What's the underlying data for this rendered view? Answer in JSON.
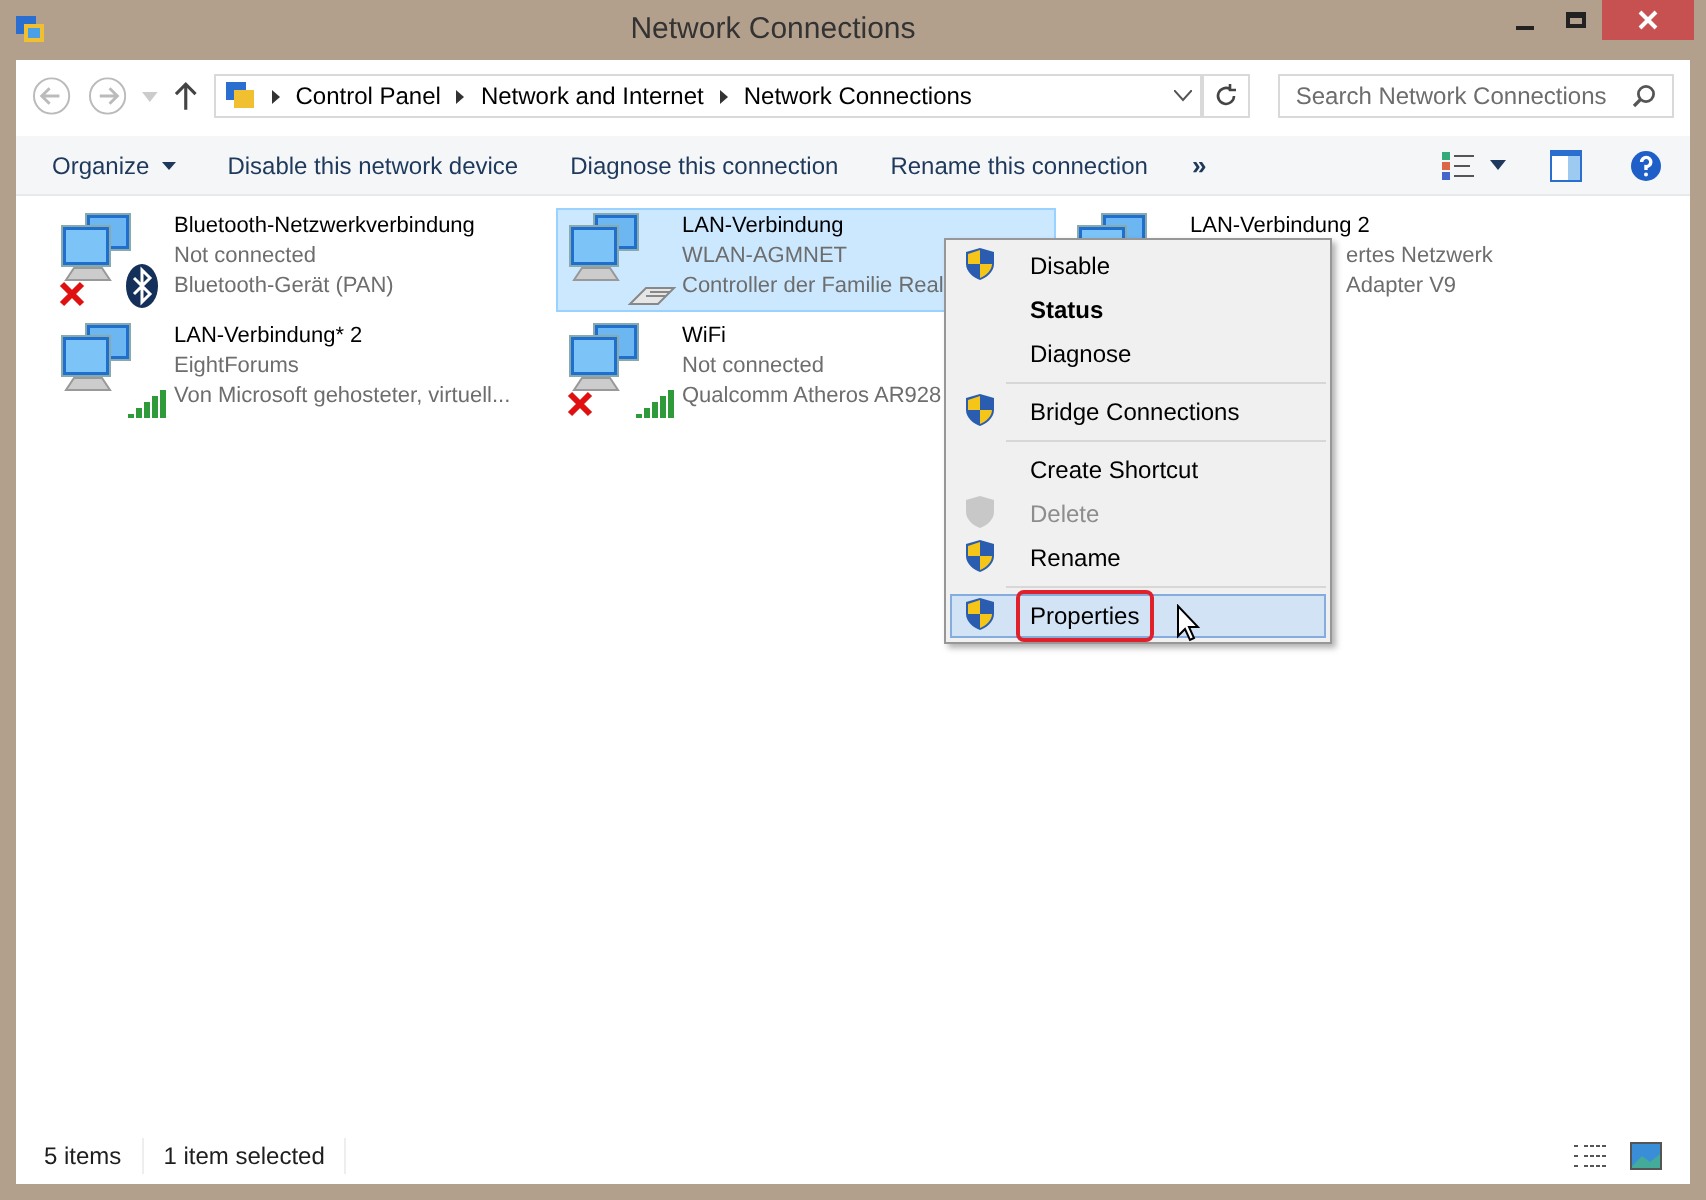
{
  "window": {
    "title": "Network Connections"
  },
  "address": {
    "crumbs": [
      "Control Panel",
      "Network and Internet",
      "Network Connections"
    ],
    "search_placeholder": "Search Network Connections"
  },
  "toolbar": {
    "items": [
      "Organize",
      "Disable this network device",
      "Diagnose this connection",
      "Rename this connection"
    ],
    "overflow": "»"
  },
  "connections": [
    {
      "name": "Bluetooth-Netzwerkverbindung",
      "line2": "Not connected",
      "line3": "Bluetooth-Gerät (PAN)",
      "kind": "bluetooth",
      "disconnected": true,
      "selected": false
    },
    {
      "name": "LAN-Verbindung",
      "line2": "WLAN-AGMNET",
      "line3": "Controller der Familie Real",
      "kind": "ethernet",
      "disconnected": false,
      "selected": true
    },
    {
      "name": "LAN-Verbindung 2",
      "line2": "ertes Netzwerk",
      "line3": "Adapter V9",
      "kind": "hidden",
      "selected": false
    },
    {
      "name": "LAN-Verbindung* 2",
      "line2": "EightForums",
      "line3": "Von Microsoft gehosteter, virtuell...",
      "kind": "signal",
      "disconnected": false,
      "selected": false
    },
    {
      "name": "WiFi",
      "line2": "Not connected",
      "line3": "Qualcomm Atheros AR928",
      "kind": "signal",
      "disconnected": true,
      "selected": false
    }
  ],
  "context_menu": [
    {
      "kind": "item",
      "label": "Disable",
      "shield": true,
      "bold": false,
      "disabled": false,
      "selected": false
    },
    {
      "kind": "item",
      "label": "Status",
      "shield": false,
      "bold": true,
      "disabled": false,
      "selected": false
    },
    {
      "kind": "item",
      "label": "Diagnose",
      "shield": false,
      "bold": false,
      "disabled": false,
      "selected": false
    },
    {
      "kind": "separator"
    },
    {
      "kind": "item",
      "label": "Bridge Connections",
      "shield": true,
      "bold": false,
      "disabled": false,
      "selected": false
    },
    {
      "kind": "separator"
    },
    {
      "kind": "item",
      "label": "Create Shortcut",
      "shield": false,
      "bold": false,
      "disabled": false,
      "selected": false
    },
    {
      "kind": "item",
      "label": "Delete",
      "shield": true,
      "bold": false,
      "disabled": true,
      "selected": false
    },
    {
      "kind": "item",
      "label": "Rename",
      "shield": true,
      "bold": false,
      "disabled": false,
      "selected": false
    },
    {
      "kind": "separator"
    },
    {
      "kind": "item",
      "label": "Properties",
      "shield": true,
      "bold": false,
      "disabled": false,
      "selected": true
    }
  ],
  "status_bar": {
    "count": "5 items",
    "selection": "1 item selected"
  }
}
